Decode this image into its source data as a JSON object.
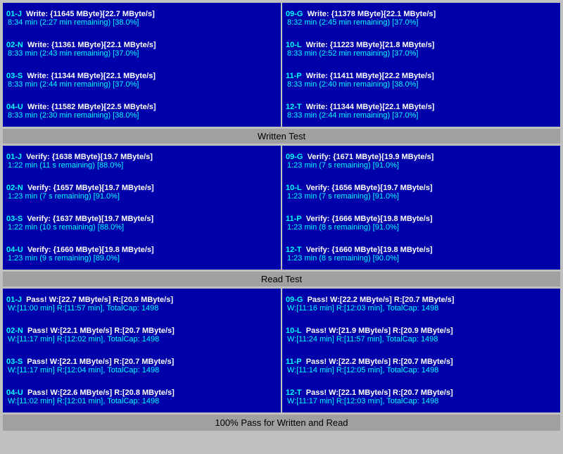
{
  "sections": {
    "write_test": {
      "label": "Written Test",
      "rows": [
        {
          "left_id": "01-J",
          "left_line1": "Write: {11645 MByte}[22.7 MByte/s]",
          "left_line2": "8:34 min (2:27 min remaining)  [38.0%]",
          "right_id": "09-G",
          "right_line1": "Write: {11378 MByte}[22.1 MByte/s]",
          "right_line2": "8:32 min (2:45 min remaining)  [37.0%]"
        },
        {
          "left_id": "02-N",
          "left_line1": "Write: {11361 MByte}[22.1 MByte/s]",
          "left_line2": "8:33 min (2:43 min remaining)  [37.0%]",
          "right_id": "10-L",
          "right_line1": "Write: {11223 MByte}[21.8 MByte/s]",
          "right_line2": "8:33 min (2:52 min remaining)  [37.0%]"
        },
        {
          "left_id": "03-S",
          "left_line1": "Write: {11344 MByte}[22.1 MByte/s]",
          "left_line2": "8:33 min (2:44 min remaining)  [37.0%]",
          "right_id": "11-P",
          "right_line1": "Write: {11411 MByte}[22.2 MByte/s]",
          "right_line2": "8:33 min (2:40 min remaining)  [38.0%]"
        },
        {
          "left_id": "04-U",
          "left_line1": "Write: {11582 MByte}[22.5 MByte/s]",
          "left_line2": "8:33 min (2:30 min remaining)  [38.0%]",
          "right_id": "12-T",
          "right_line1": "Write: {11344 MByte}[22.1 MByte/s]",
          "right_line2": "8:33 min (2:44 min remaining)  [37.0%]"
        }
      ]
    },
    "verify_test": {
      "label": "Written Test",
      "rows": [
        {
          "left_id": "01-J",
          "left_line1": "Verify: {1638 MByte}[19.7 MByte/s]",
          "left_line2": "1:22 min (11 s remaining)  [88.0%]",
          "right_id": "09-G",
          "right_line1": "Verify: {1671 MByte}[19.9 MByte/s]",
          "right_line2": "1:23 min (7 s remaining)  [91.0%]"
        },
        {
          "left_id": "02-N",
          "left_line1": "Verify: {1657 MByte}[19.7 MByte/s]",
          "left_line2": "1:23 min (7 s remaining)  [91.0%]",
          "right_id": "10-L",
          "right_line1": "Verify: {1656 MByte}[19.7 MByte/s]",
          "right_line2": "1:23 min (7 s remaining)  [91.0%]"
        },
        {
          "left_id": "03-S",
          "left_line1": "Verify: {1637 MByte}[19.7 MByte/s]",
          "left_line2": "1:22 min (10 s remaining)  [88.0%]",
          "right_id": "11-P",
          "right_line1": "Verify: {1666 MByte}[19.8 MByte/s]",
          "right_line2": "1:23 min (8 s remaining)  [91.0%]"
        },
        {
          "left_id": "04-U",
          "left_line1": "Verify: {1660 MByte}[19.8 MByte/s]",
          "left_line2": "1:23 min (9 s remaining)  [89.0%]",
          "right_id": "12-T",
          "right_line1": "Verify: {1660 MByte}[19.8 MByte/s]",
          "right_line2": "1:23 min (8 s remaining)  [90.0%]"
        }
      ]
    },
    "read_test": {
      "label": "Read Test",
      "rows": [
        {
          "left_id": "01-J",
          "left_line1": "Pass! W:[22.7 MByte/s] R:[20.9 MByte/s]",
          "left_line2": "W:[11:00 min] R:[11:57 min], TotalCap: 1498",
          "right_id": "09-G",
          "right_line1": "Pass! W:[22.2 MByte/s] R:[20.7 MByte/s]",
          "right_line2": "W:[11:16 min] R:[12:03 min], TotalCap: 1498"
        },
        {
          "left_id": "02-N",
          "left_line1": "Pass! W:[22.1 MByte/s] R:[20.7 MByte/s]",
          "left_line2": "W:[11:17 min] R:[12:02 min], TotalCap: 1498",
          "right_id": "10-L",
          "right_line1": "Pass! W:[21.9 MByte/s] R:[20.9 MByte/s]",
          "right_line2": "W:[11:24 min] R:[11:57 min], TotalCap: 1498"
        },
        {
          "left_id": "03-S",
          "left_line1": "Pass! W:[22.1 MByte/s] R:[20.7 MByte/s]",
          "left_line2": "W:[11:17 min] R:[12:04 min], TotalCap: 1498",
          "right_id": "11-P",
          "right_line1": "Pass! W:[22.2 MByte/s] R:[20.7 MByte/s]",
          "right_line2": "W:[11:14 min] R:[12:05 min], TotalCap: 1498"
        },
        {
          "left_id": "04-U",
          "left_line1": "Pass! W:[22.6 MByte/s] R:[20.8 MByte/s]",
          "left_line2": "W:[11:02 min] R:[12:01 min], TotalCap: 1498",
          "right_id": "12-T",
          "right_line1": "Pass! W:[22.1 MByte/s] R:[20.7 MByte/s]",
          "right_line2": "W:[11:17 min] R:[12:03 min], TotalCap: 1498"
        }
      ]
    }
  },
  "dividers": {
    "written_test": "Written Test",
    "read_test": "Read Test",
    "final_status": "100% Pass for Written and Read"
  }
}
